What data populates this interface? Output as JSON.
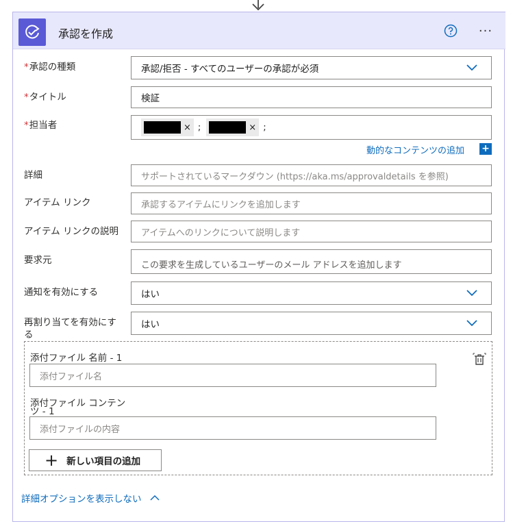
{
  "header": {
    "title": "承認を作成",
    "icons": {
      "action": "approval-icon",
      "help": "question-mark-icon",
      "more": "ellipsis-icon"
    },
    "more_label": "···"
  },
  "colors": {
    "accent": "#5a5ad6",
    "header_bg": "#e8e8fc",
    "link": "#0f6cbd",
    "required": "#d13438"
  },
  "form": {
    "approval_type": {
      "label": "承認の種類",
      "required_mark": "*",
      "value": "承認/拒否 - すべてのユーザーの承認が必須"
    },
    "title": {
      "label": "タイトル",
      "required_mark": "*",
      "value": "検証"
    },
    "assigned_to": {
      "label": "担当者",
      "required_mark": "*",
      "remove": "×",
      "separator": ";"
    },
    "dynamic_content": {
      "label": "動的なコンテンツの追加",
      "plus": "+"
    },
    "details": {
      "label": "詳細",
      "placeholder": "サポートされているマークダウン (https://aka.ms/approvaldetails を参照)"
    },
    "item_link": {
      "label": "アイテム リンク",
      "placeholder": "承認するアイテムにリンクを追加します"
    },
    "item_link_desc": {
      "label": "アイテム リンクの説明",
      "placeholder": "アイテムへのリンクについて説明します"
    },
    "requestor": {
      "label": "要求元",
      "placeholder": "この要求を生成しているユーザーのメール アドレスを追加します"
    },
    "enable_notifications": {
      "label": "通知を有効にする",
      "value": "はい"
    },
    "enable_reassignment": {
      "label_line1": "再割り当てを有効にす",
      "label_line2": "る",
      "value": "はい"
    }
  },
  "attachments": {
    "name_label": "添付ファイル 名前 - 1",
    "name_placeholder": "添付ファイル名",
    "content_label_line1": "添付ファイル コンテン",
    "content_label_line2": "ツ - 1",
    "content_placeholder": "添付ファイルの内容",
    "add_item_label": "新しい項目の追加",
    "add_item_plus": "+"
  },
  "footer": {
    "advanced_options_label": "詳細オプションを表示しない"
  }
}
